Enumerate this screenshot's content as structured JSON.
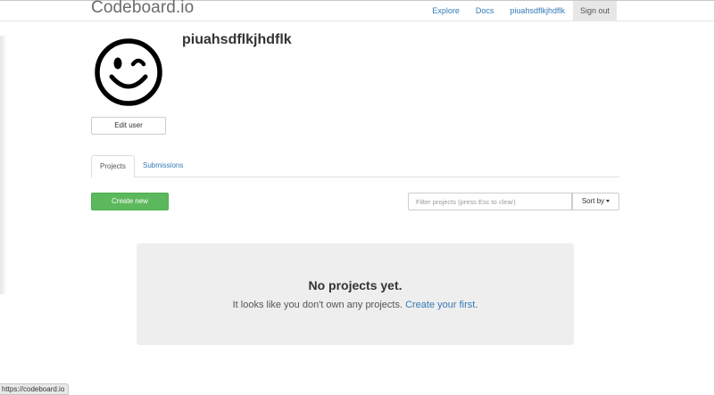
{
  "navbar": {
    "brand": "Codeboard.io",
    "links": [
      {
        "label": "Explore"
      },
      {
        "label": "Docs"
      },
      {
        "label": "piuahsdflkjhdflk"
      },
      {
        "label": "Sign out"
      }
    ]
  },
  "profile": {
    "username": "piuahsdflkjhdflk",
    "avatar_icon": "smiley-face-icon",
    "edit_label": "Edit user"
  },
  "tabs": [
    {
      "label": "Projects",
      "active": true
    },
    {
      "label": "Submissions",
      "active": false
    }
  ],
  "toolbar": {
    "create_label": "Create new",
    "filter_placeholder": "Filter projects (press Esc to clear)",
    "filter_value": "",
    "sort_label": "Sort by"
  },
  "empty_state": {
    "title": "No projects yet.",
    "text": "It looks like you don't own any projects.",
    "link": "Create your first",
    "suffix": "."
  },
  "status_bar": {
    "url": "https://codeboard.io"
  },
  "colors": {
    "link": "#337ab7",
    "success": "#5cb85c",
    "empty_bg": "#eeeeee"
  }
}
